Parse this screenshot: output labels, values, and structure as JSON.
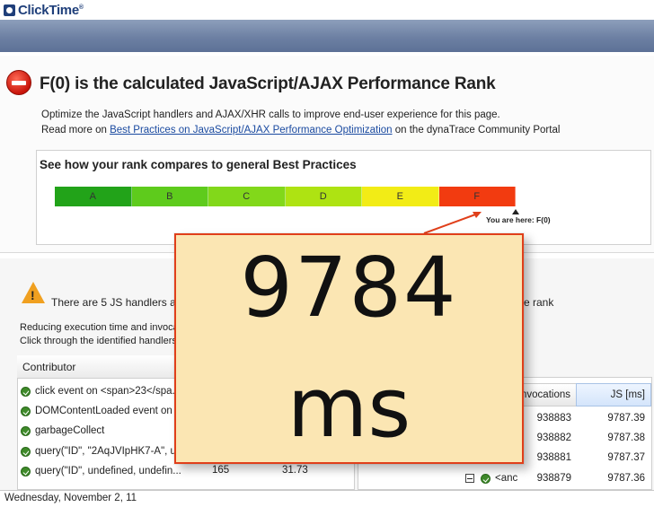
{
  "app": {
    "brand": "ClickTime",
    "trademark": "®"
  },
  "rank_panel": {
    "title": "F(0) is the calculated JavaScript/AJAX Performance Rank",
    "desc_line1": "Optimize the JavaScript handlers and AJAX/XHR calls to improve end-user experience for this page.",
    "desc_line2_prefix": "Read more on ",
    "desc_link": "Best Practices on JavaScript/AJAX Performance Optimization",
    "desc_line2_suffix": " on the dynaTrace Community Portal",
    "compare_title": "See how your rank compares to general Best Practices",
    "grades": [
      {
        "label": "A",
        "color": "#22a319"
      },
      {
        "label": "B",
        "color": "#5ecb1c"
      },
      {
        "label": "C",
        "color": "#82d81a"
      },
      {
        "label": "D",
        "color": "#aee312"
      },
      {
        "label": "E",
        "color": "#f2ec16"
      },
      {
        "label": "F",
        "color": "#f23b10"
      }
    ],
    "you_are_here": "You are here: F(0)"
  },
  "handlers_panel": {
    "warning_text": "There are 5 JS handlers and jQ",
    "rank_text_right": "e rank",
    "reduce_line1": "Reducing execution time and invocatio",
    "reduce_line2": "Click through the identified handlers _r",
    "contributor_header": "Contributor",
    "rows": [
      {
        "label": "click event on <span>23</spa..."
      },
      {
        "label": "DOMContentLoaded event on ..."
      },
      {
        "label": "garbageCollect"
      },
      {
        "label": "query(\"ID\", \"2AqJVIpHK7-A\", u..."
      },
      {
        "label": "query(\"ID\", undefined, undefin...",
        "count": "165",
        "ms": "31.73"
      }
    ]
  },
  "right_table": {
    "col_invocations": "nvocations",
    "col_js": "JS [ms]",
    "rows": [
      {
        "invocations": "938883",
        "js": "9787.39"
      },
      {
        "invocations": "938882",
        "js": "9787.38"
      },
      {
        "invocations": "938881",
        "js": "9787.37"
      },
      {
        "invocations": "938879",
        "js": "9787.36"
      }
    ],
    "last_row_label": "<anc"
  },
  "callout": {
    "value": "9784",
    "unit": "ms"
  },
  "footer": {
    "date": "Wednesday, November 2, 11"
  },
  "colors": {
    "callout_fill": "#fbe6b3",
    "callout_border": "#e03f1a",
    "link": "#1a4aa0"
  }
}
